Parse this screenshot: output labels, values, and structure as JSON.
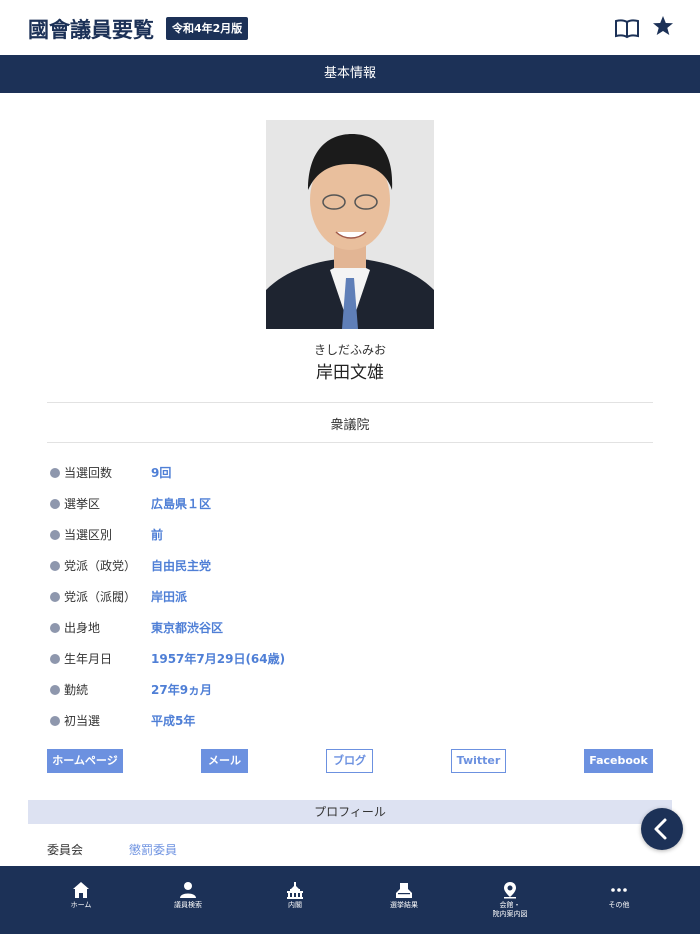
{
  "header": {
    "title": "國會議員要覧",
    "edition": "令和4年2月版",
    "book_icon": "book-open-icon",
    "star_icon": "star-icon"
  },
  "section_title": "基本情報",
  "member": {
    "kana": "きしだふみお",
    "name": "岸田文雄",
    "house": "衆議院"
  },
  "info": [
    {
      "label": "当選回数",
      "value": "9回"
    },
    {
      "label": "選挙区",
      "value": "広島県１区"
    },
    {
      "label": "当選区別",
      "value": "前"
    },
    {
      "label": "党派（政党）",
      "value": "自由民主党"
    },
    {
      "label": "党派（派閥）",
      "value": "岸田派"
    },
    {
      "label": "出身地",
      "value": "東京都渋谷区"
    },
    {
      "label": "生年月日",
      "value": "1957年7月29日(64歳)"
    },
    {
      "label": "勤続",
      "value": "27年9ヵ月"
    },
    {
      "label": "初当選",
      "value": "平成5年"
    }
  ],
  "links": {
    "homepage": "ホームページ",
    "mail": "メール",
    "blog": "ブログ",
    "twitter": "Twitter",
    "facebook": "Facebook"
  },
  "profile": {
    "title": "プロフィール",
    "committee_label": "委員会",
    "committee_value": "懲罰委員"
  },
  "tabs": {
    "home": "ホーム",
    "search": "議員検索",
    "cabinet": "内閣",
    "election": "選挙結果",
    "guide_line1": "会館・",
    "guide_line2": "院内案内図",
    "other": "その他"
  },
  "colors": {
    "navy": "#1c3157",
    "link_blue": "#4f7fd6",
    "button_blue": "#6c91e0",
    "profile_bar": "#dde2f2"
  }
}
